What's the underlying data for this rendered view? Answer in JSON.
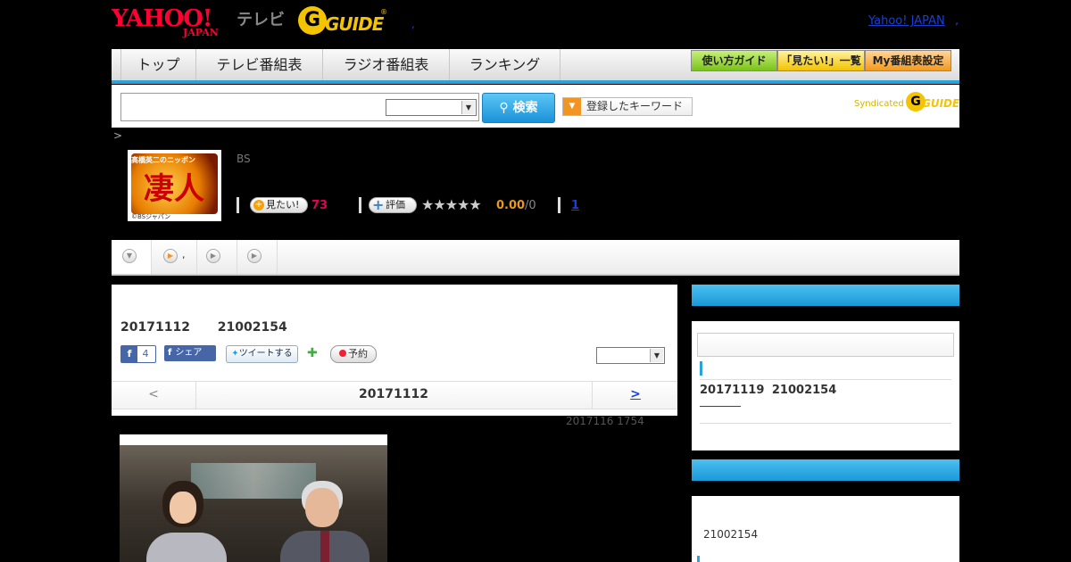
{
  "header": {
    "yahoo_logo": "YAHOO!",
    "yahoo_japan": "JAPAN",
    "tv_word": "テレビ",
    "gguide_g": "G",
    "gguide_text": "GUIDE",
    "gguide_mark": "®",
    "comma": ",",
    "yahoo_japan_link": "Yahoo! JAPAN",
    "trailing_comma": ","
  },
  "nav": {
    "items": [
      "トップ",
      "テレビ番組表",
      "ラジオ番組表",
      "ランキング"
    ],
    "right_buttons": [
      "使い方ガイド",
      "「見たい!」一覧",
      "My番組表設定"
    ]
  },
  "search": {
    "input_value": "",
    "button_label": "検索",
    "keyword_button": "登録したキーワード",
    "syndicated_text": "Syndicated",
    "syndicated_g": "G",
    "syndicated_guide": "GUIDE"
  },
  "breadcrumb": ">",
  "program": {
    "thumbnail_top": "高橋英二のニッポン",
    "thumbnail_kanji": "凄人",
    "thumbnail_caption": "©BSジャパン",
    "channel": "BS",
    "mitai_label": "見たい!",
    "mitai_count": "73",
    "rate_label": "評価",
    "stars": "★★★★★",
    "score": "0.00",
    "score_total": "/0",
    "review_count": "1"
  },
  "tabs": [
    {
      "icon": "chevron-down-icon",
      "label": ""
    },
    {
      "icon": "play-icon",
      "label": ","
    },
    {
      "icon": "play-icon",
      "label": ""
    },
    {
      "icon": "play-icon",
      "label": ""
    }
  ],
  "main": {
    "date_title": "20171112 21002154",
    "fb_count": "4",
    "share_label": "シェア",
    "tweet_label": "ツイートする",
    "yoyaku_label": "予約",
    "prev_label": "<",
    "current_date": "20171112",
    "next_label": ">",
    "updated": "2017116  1754"
  },
  "sidebar": {
    "next_item": "20171119  21002154",
    "section2_text": "21002154"
  },
  "colors": {
    "accent_blue": "#29a3d8",
    "yahoo_red": "#ff0033",
    "gguide_yellow": "#f5c400",
    "mitai_pink": "#e8005a",
    "link_blue": "#1a3fd9"
  }
}
